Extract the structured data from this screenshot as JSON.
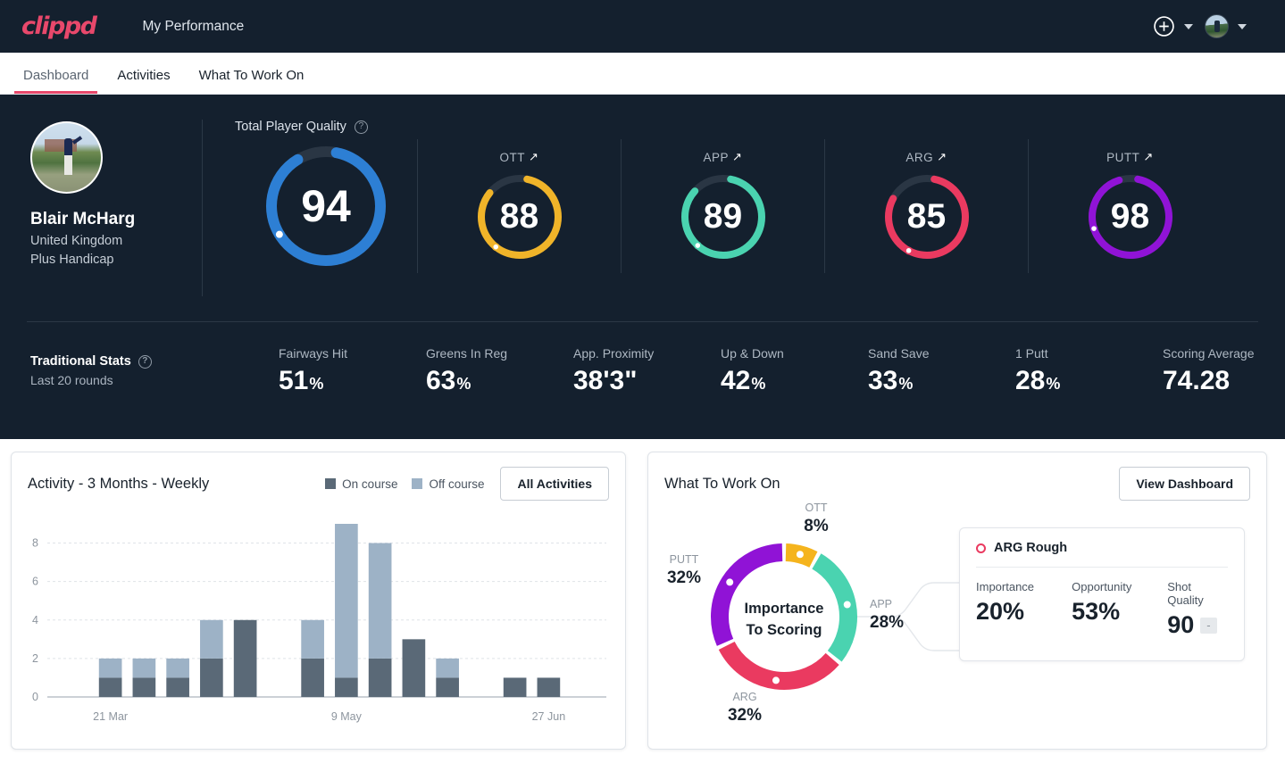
{
  "brand": "clippd",
  "header": {
    "title": "My Performance",
    "add_icon": "plus-circle-icon",
    "add_chevron": "chevron-down-icon",
    "avatar_chevron": "chevron-down-icon"
  },
  "tabs": [
    {
      "label": "Dashboard",
      "active": true
    },
    {
      "label": "Activities",
      "active": false
    },
    {
      "label": "What To Work On",
      "active": false
    }
  ],
  "profile": {
    "name": "Blair McHarg",
    "country": "United Kingdom",
    "handicap": "Plus Handicap"
  },
  "player_quality": {
    "title": "Total Player Quality",
    "help_icon": "question-mark-icon",
    "overall": {
      "value": "94",
      "color": "#2d7fd4",
      "pct": 94
    },
    "metrics": [
      {
        "label": "OTT",
        "trend_icon": "arrow-up-right-icon",
        "value": "88",
        "color": "#f0b429",
        "pct": 88
      },
      {
        "label": "APP",
        "trend_icon": "arrow-up-right-icon",
        "value": "89",
        "color": "#4ad3b0",
        "pct": 89
      },
      {
        "label": "ARG",
        "trend_icon": "arrow-up-right-icon",
        "value": "85",
        "color": "#ea3a60",
        "pct": 85
      },
      {
        "label": "PUTT",
        "trend_icon": "arrow-up-right-icon",
        "value": "98",
        "color": "#9013d6",
        "pct": 98
      }
    ]
  },
  "traditional_stats": {
    "title": "Traditional Stats",
    "help_icon": "question-mark-icon",
    "subtitle": "Last 20 rounds",
    "items": [
      {
        "label": "Fairways Hit",
        "value": "51",
        "unit": "%"
      },
      {
        "label": "Greens In Reg",
        "value": "63",
        "unit": "%"
      },
      {
        "label": "App. Proximity",
        "value": "38'3\"",
        "unit": ""
      },
      {
        "label": "Up & Down",
        "value": "42",
        "unit": "%"
      },
      {
        "label": "Sand Save",
        "value": "33",
        "unit": "%"
      },
      {
        "label": "1 Putt",
        "value": "28",
        "unit": "%"
      },
      {
        "label": "Scoring Average",
        "value": "74.28",
        "unit": ""
      }
    ]
  },
  "activity_card": {
    "title": "Activity - 3 Months - Weekly",
    "legend": [
      {
        "label": "On course",
        "color": "#5a6977"
      },
      {
        "label": "Off course",
        "color": "#9db2c6"
      }
    ],
    "button": "All Activities"
  },
  "chart_data": {
    "type": "bar",
    "title": "Activity - 3 Months - Weekly",
    "stacked": true,
    "xlabel": "",
    "ylabel": "",
    "ylim": [
      0,
      9
    ],
    "yticks": [
      "0",
      "2",
      "4",
      "6",
      "8"
    ],
    "grid": true,
    "xtick_labels": [
      "21 Mar",
      "9 May",
      "27 Jun"
    ],
    "xtick_indices": [
      1,
      8,
      14
    ],
    "categories": [
      "w1",
      "w2",
      "w3",
      "w4",
      "w5",
      "w6",
      "w7",
      "w8",
      "w9",
      "w10",
      "w11",
      "w12",
      "w13",
      "w14",
      "w15",
      "w16"
    ],
    "series": [
      {
        "name": "On course",
        "color": "#5a6977",
        "values": [
          0,
          1,
          1,
          1,
          2,
          4,
          0,
          2,
          1,
          2,
          3,
          1,
          0,
          1,
          1,
          0
        ]
      },
      {
        "name": "Off course",
        "color": "#9db2c6",
        "values": [
          0,
          1,
          1,
          1,
          2,
          0,
          0,
          2,
          8,
          6,
          0,
          1,
          0,
          0,
          0,
          0
        ]
      }
    ]
  },
  "wtwo_card": {
    "title": "What To Work On",
    "button": "View Dashboard",
    "donut": {
      "center_line1": "Importance",
      "center_line2": "To Scoring",
      "segments": [
        {
          "label": "OTT",
          "value": "8%",
          "pct": 8,
          "color": "#f5b41d"
        },
        {
          "label": "APP",
          "value": "28%",
          "pct": 28,
          "color": "#4ad3b0"
        },
        {
          "label": "ARG",
          "value": "32%",
          "pct": 32,
          "color": "#ea3a60"
        },
        {
          "label": "PUTT",
          "value": "32%",
          "pct": 32,
          "color": "#9013d6"
        }
      ]
    },
    "detail": {
      "marker_icon": "circle-outline-icon",
      "marker_color": "#ea3a60",
      "title": "ARG Rough",
      "metrics": [
        {
          "label": "Importance",
          "value": "20%"
        },
        {
          "label": "Opportunity",
          "value": "53%"
        },
        {
          "label": "Shot Quality",
          "value": "90",
          "badge": "-"
        }
      ]
    }
  }
}
